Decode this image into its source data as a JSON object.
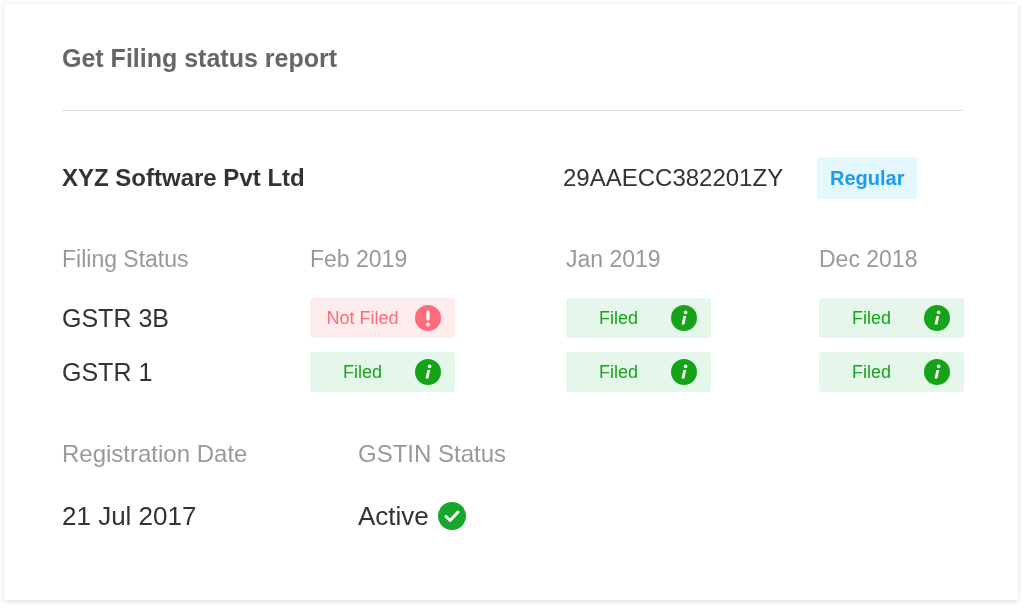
{
  "title": "Get Filing status report",
  "company": {
    "name": "XYZ Software Pvt Ltd",
    "gstin": "29AAECC382201ZY",
    "badge": "Regular"
  },
  "filing_table": {
    "corner_label": "Filing Status",
    "columns": [
      "Feb 2019",
      "Jan 2019",
      "Dec 2018"
    ],
    "rows": [
      {
        "name": "GSTR 3B",
        "cells": [
          {
            "status": "Not Filed",
            "kind": "not_filed"
          },
          {
            "status": "Filed",
            "kind": "filed"
          },
          {
            "status": "Filed",
            "kind": "filed"
          }
        ]
      },
      {
        "name": "GSTR 1",
        "cells": [
          {
            "status": "Filed",
            "kind": "filed"
          },
          {
            "status": "Filed",
            "kind": "filed"
          },
          {
            "status": "Filed",
            "kind": "filed"
          }
        ]
      }
    ]
  },
  "details": [
    {
      "label": "Registration Date",
      "value": "21 Jul 2017",
      "kind": "plain"
    },
    {
      "label": "GSTIN Status",
      "value": "Active",
      "kind": "verified"
    }
  ]
}
